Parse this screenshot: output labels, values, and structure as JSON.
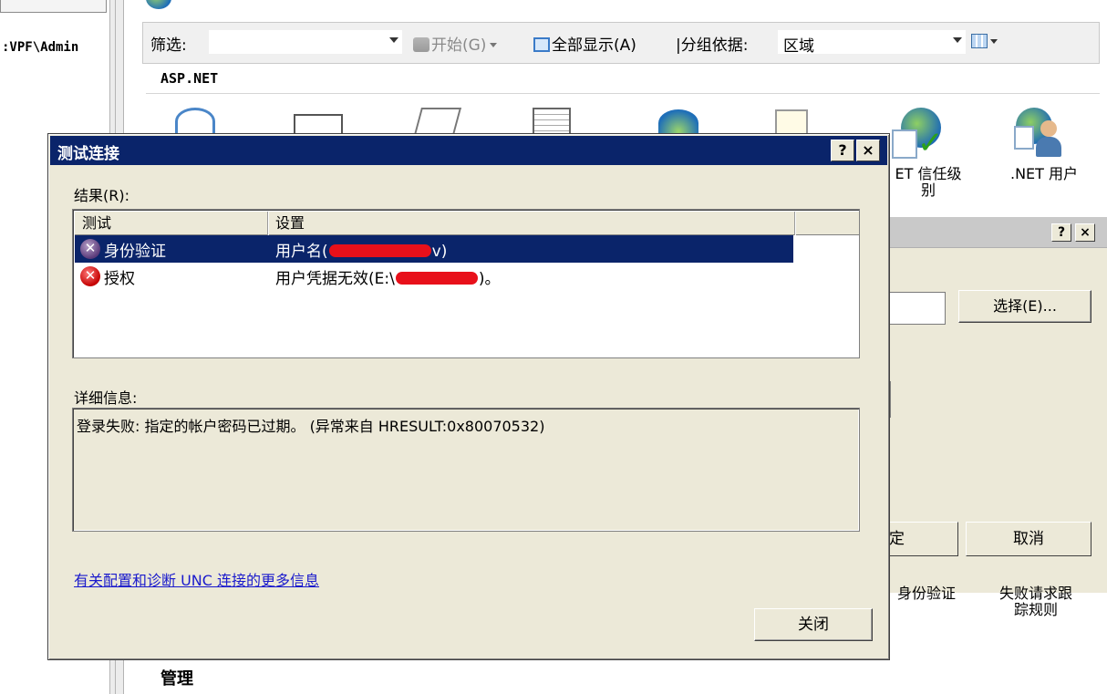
{
  "background": {
    "left_path": ":VPF\\Admin",
    "filter_bar": {
      "filter_label": "筛选:",
      "filter_value": "",
      "start_label": "开始(G)",
      "show_all_label": "全部显示(A)",
      "group_by_label": "|分组依据:",
      "group_by_value": "区域"
    },
    "section_aspnet": "ASP.NET",
    "features": {
      "trust_level": "ET 信任级\n别",
      "net_users": ".NET 用户",
      "authentication": "身份验证",
      "failed_request_tracing": "失败请求跟\n踪规则"
    },
    "section_manage": "管理",
    "child_dialog": {
      "help": "?",
      "close": "×",
      "select_button": "选择(E)...",
      "ok_button": "定",
      "cancel_button": "取消"
    }
  },
  "dialog": {
    "title": "测试连接",
    "help_button": "?",
    "close_button": "×",
    "results_label": "结果(R):",
    "columns": [
      "测试",
      "设置"
    ],
    "rows": [
      {
        "test": "身份验证",
        "setting_prefix": "用户名(",
        "setting_suffix": "v)",
        "status": "error",
        "selected": true
      },
      {
        "test": "授权",
        "setting_prefix": "用户凭据无效(E:\\",
        "setting_suffix": ")。",
        "status": "error",
        "selected": false
      }
    ],
    "details_label": "详细信息:",
    "details_text": "登录失败: 指定的帐户密码已过期。 (异常来自 HRESULT:0x80070532)",
    "help_link": "有关配置和诊断 UNC 连接的更多信息",
    "close_label": "关闭"
  },
  "colors": {
    "title_bar": "#0a246a",
    "dialog_face": "#ece9d8",
    "link": "#1a1acc",
    "redaction": "#e8101a"
  },
  "icons": [
    "globe-icon",
    "binoculars-icon",
    "show-all-icon",
    "view-toggle-icon",
    "trust-level-icon",
    "net-users-icon",
    "error-icon"
  ]
}
